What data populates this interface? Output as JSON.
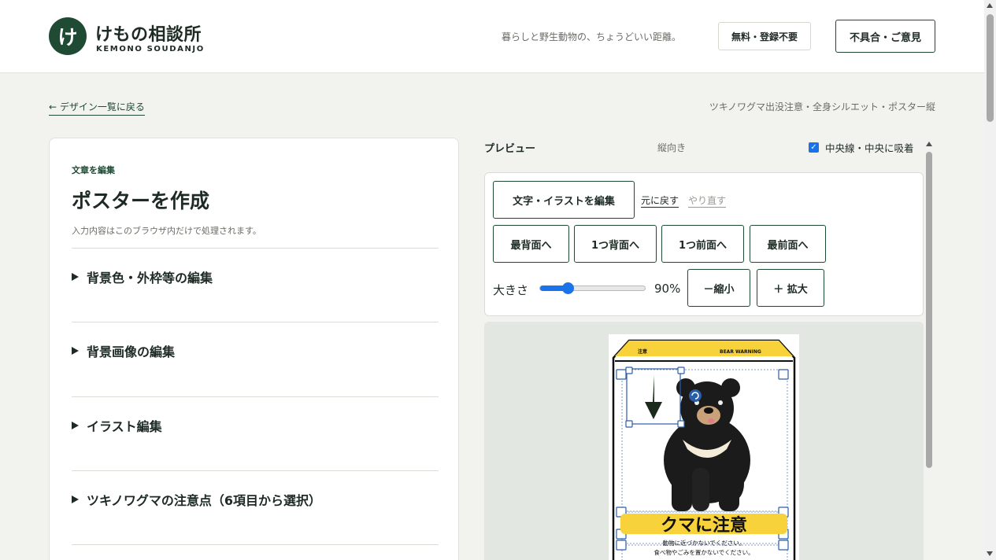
{
  "header": {
    "logo_glyph": "け",
    "logo_title": "けもの相談所",
    "logo_subtitle": "KEMONO SOUDANJO",
    "tagline": "暮らしと野生動物の、ちょうどいい距離。",
    "free_badge": "無料・登録不要",
    "feedback_button": "不具合・ご意見"
  },
  "breadcrumb": {
    "back_link": "← デザイン一覧に戻る",
    "design_name": "ツキノワグマ出没注意・全身シルエット・ポスター縦"
  },
  "editor": {
    "eyebrow": "文章を編集",
    "title": "ポスターを作成",
    "note": "入力内容はこのブラウザ内だけで処理されます。",
    "sections": [
      {
        "label": "背景色・外枠等の編集"
      },
      {
        "label": "背景画像の編集"
      },
      {
        "label": "イラスト編集"
      },
      {
        "label": "ツキノワグマの注意点（6項目から選択）"
      }
    ]
  },
  "preview": {
    "label": "プレビュー",
    "orientation": "縦向き",
    "snap_label": "中央線・中央に吸着",
    "snap_checked": true
  },
  "toolbar": {
    "edit_button": "文字・イラストを編集",
    "undo": "元に戻す",
    "redo": "やり直す",
    "to_back": "最背面へ",
    "backward": "1つ背面へ",
    "forward": "1つ前面へ",
    "to_front": "最前面へ",
    "size_label": "大きさ",
    "size_value": "90%",
    "size_percent": 90,
    "shrink_button": "－縮小",
    "enlarge_button": "＋ 拡大"
  },
  "poster": {
    "top_left_label": "注意",
    "top_right_label": "BEAR WARNING",
    "headline": "クマに注意",
    "line1": "動物に近づかないでください。",
    "line2": "食べ物やごみを置かないでください。"
  },
  "colors": {
    "brand_green": "#1f4a34",
    "accent_blue": "#1a73e8",
    "poster_yellow": "#f7d23a",
    "canvas_bg": "#e3e7e1"
  }
}
